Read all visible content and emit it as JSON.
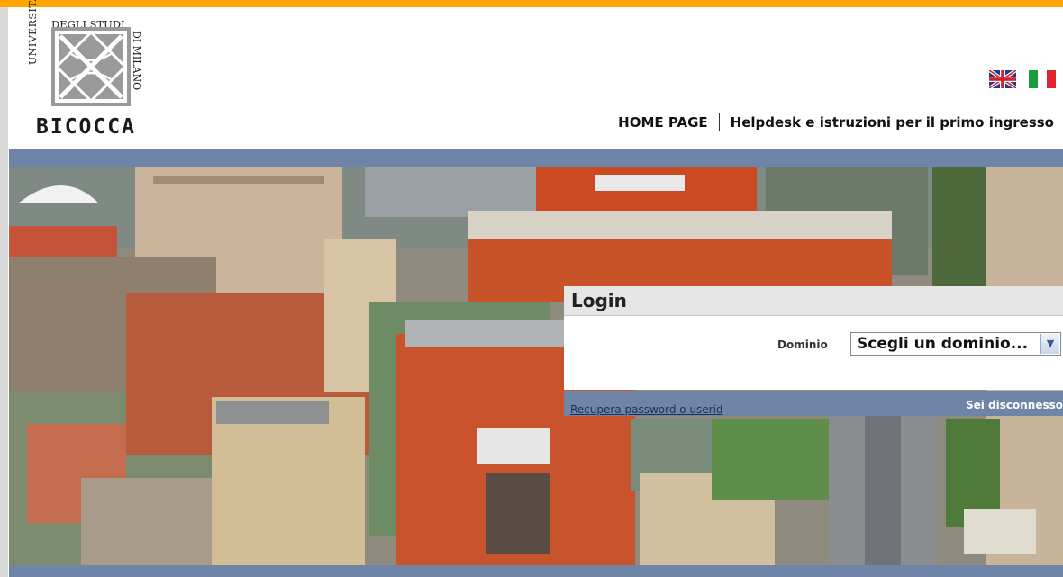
{
  "header": {
    "logo": {
      "arc_left": "UNIVERSITA' DEGLI STUDI",
      "arc_top": "DEGLI STUDI",
      "arc_right": "DI MILANO",
      "name": "BICOCCA"
    },
    "flags": [
      {
        "name": "english",
        "icon": "uk-flag-icon"
      },
      {
        "name": "italiano",
        "icon": "italy-flag-icon"
      }
    ],
    "nav": {
      "home": "HOME PAGE",
      "help": "Helpdesk e istruzioni per il primo ingresso"
    }
  },
  "colors": {
    "accent": "#ffa500",
    "band": "#6f85a8",
    "panel_head": "#e6e6e6"
  },
  "login": {
    "title": "Login",
    "domain_label": "Dominio",
    "domain_value": "Scegli un dominio...",
    "recover_link": "Recupera password o userid",
    "status": "Sei disconnesso"
  }
}
